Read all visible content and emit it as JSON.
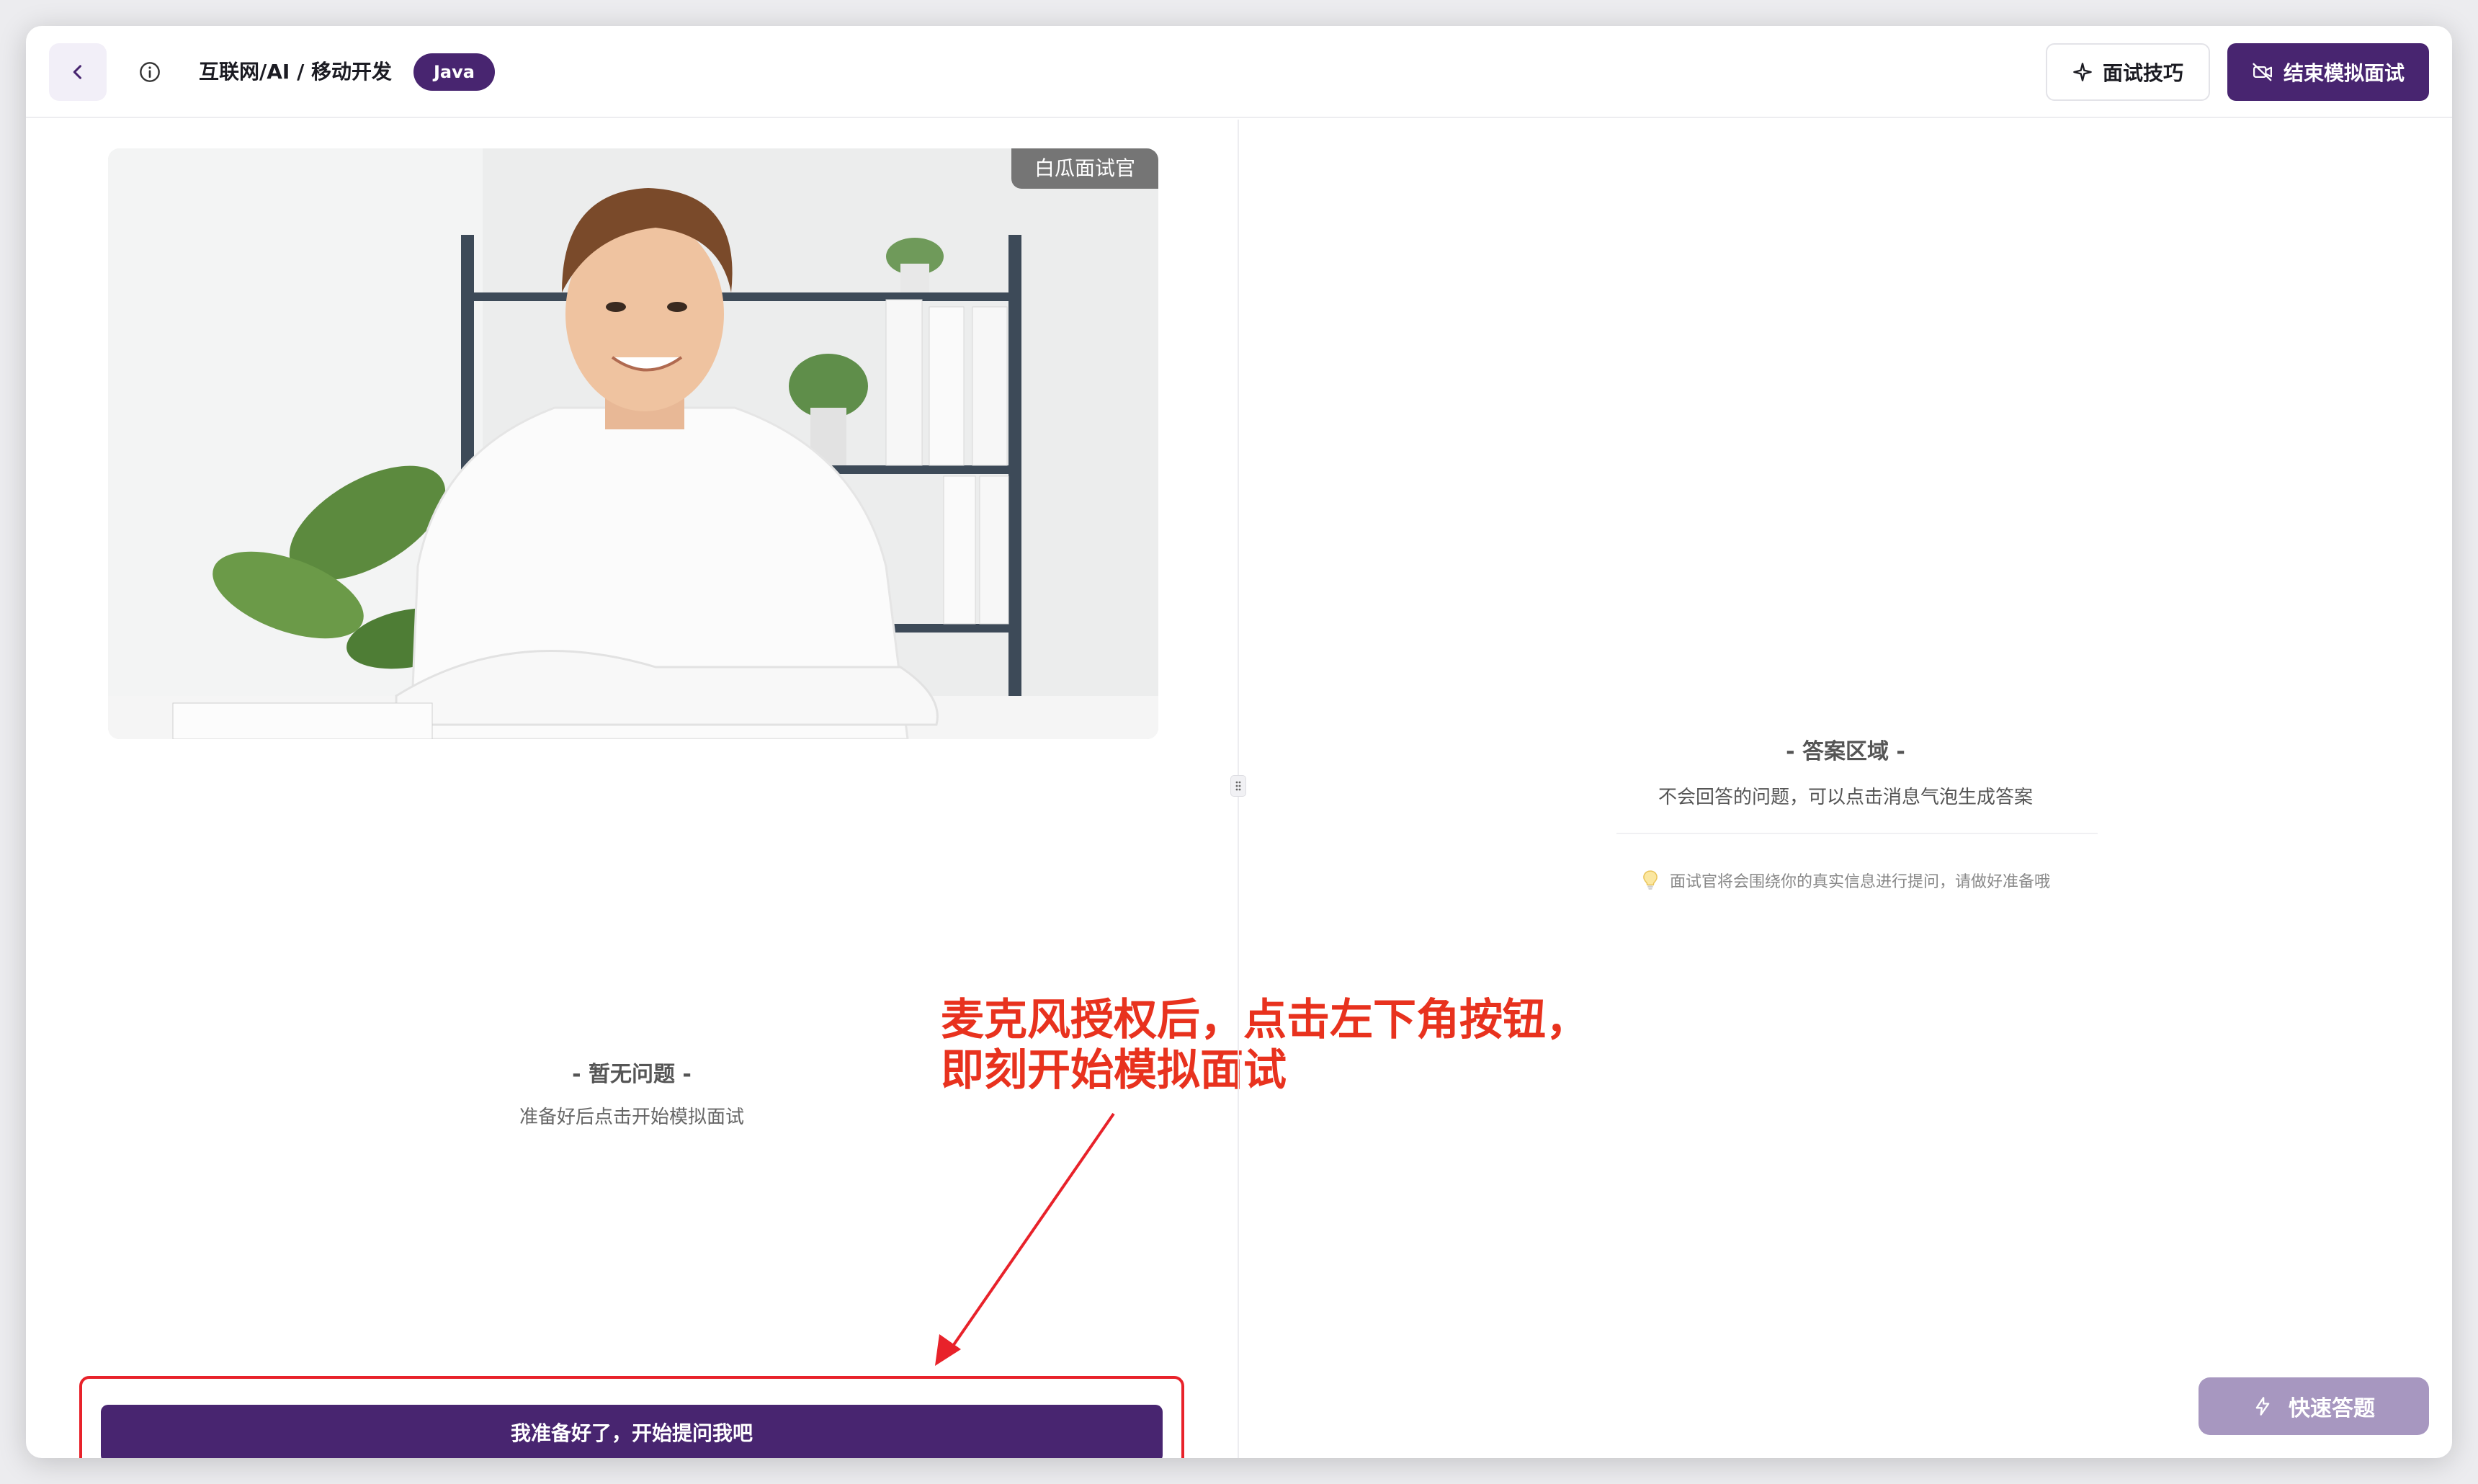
{
  "header": {
    "breadcrumb": "互联网/AI / 移动开发",
    "tag": "Java",
    "tips_label": "面试技巧",
    "end_label": "结束模拟面试"
  },
  "video": {
    "label": "白瓜面试官"
  },
  "question_area": {
    "title": "- 暂无问题 -",
    "subtitle": "准备好后点击开始模拟面试",
    "start_label": "我准备好了，开始提问我吧"
  },
  "answer_area": {
    "title": "- 答案区域 -",
    "subtitle": "不会回答的问题，可以点击消息气泡生成答案",
    "hint": "面试官将会围绕你的真实信息进行提问，请做好准备哦",
    "quick_label": "快速答题"
  },
  "annotation": {
    "line1": "麦克风授权后，点击左下角按钮，",
    "line2": "即刻开始模拟面试"
  },
  "colors": {
    "brand": "#482570",
    "annotation": "#e8321e",
    "quick_disabled": "#a797c0"
  },
  "icons": [
    "chevron-left-icon",
    "info-icon",
    "sparkle-icon",
    "video-off-icon",
    "lightbulb-icon",
    "lightning-icon",
    "drag-handle-icon"
  ]
}
